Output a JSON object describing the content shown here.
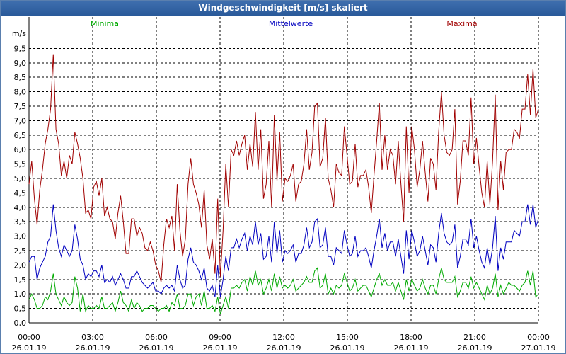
{
  "window": {
    "title": "Windgeschwindigkeit [m/s] skaliert"
  },
  "chart_data": {
    "type": "line",
    "title": "Windgeschwindigkeit [m/s] skaliert",
    "ylabel": "m/s",
    "xlabel": "",
    "ylim": [
      0,
      10
    ],
    "xlim": [
      0,
      24
    ],
    "grid": true,
    "y_ticks": [
      "0,0",
      "0,5",
      "1,0",
      "1,5",
      "2,0",
      "2,5",
      "3,0",
      "3,5",
      "4,0",
      "4,5",
      "5,0",
      "5,5",
      "6,0",
      "6,5",
      "7,0",
      "7,5",
      "8,0",
      "8,5",
      "9,0",
      "9,5"
    ],
    "x_ticks": [
      {
        "time": "00:00",
        "date": "26.01.19"
      },
      {
        "time": "03:00",
        "date": "26.01.19"
      },
      {
        "time": "06:00",
        "date": "26.01.19"
      },
      {
        "time": "09:00",
        "date": "26.01.19"
      },
      {
        "time": "12:00",
        "date": "26.01.19"
      },
      {
        "time": "15:00",
        "date": "26.01.19"
      },
      {
        "time": "18:00",
        "date": "26.01.19"
      },
      {
        "time": "21:00",
        "date": "26.01.19"
      },
      {
        "time": "00:00",
        "date": "27.01.19"
      }
    ],
    "series": [
      {
        "name": "Minima",
        "color": "#00aa00",
        "values": [
          0.8,
          1.0,
          0.8,
          0.5,
          0.5,
          0.6,
          0.9,
          0.8,
          1.1,
          1.7,
          1.0,
          0.8,
          0.6,
          0.9,
          0.7,
          0.6,
          0.7,
          1.6,
          1.2,
          0.4,
          1.0,
          0.4,
          0.6,
          0.5,
          0.5,
          0.6,
          0.5,
          0.9,
          0.5,
          0.5,
          0.6,
          0.7,
          0.4,
          0.7,
          1.1,
          0.7,
          0.6,
          0.4,
          0.8,
          0.5,
          0.7,
          0.6,
          0.4,
          0.5,
          0.5,
          0.6,
          0.6,
          0.5,
          0.4,
          0.5,
          0.5,
          0.6,
          0.4,
          0.7,
          0.6,
          1.0,
          0.5,
          0.5,
          0.6,
          1.0,
          1.0,
          0.6,
          0.9,
          1.0,
          0.6,
          1.1,
          0.5,
          0.5,
          0.6,
          0.4,
          0.9,
          0.3,
          0.6,
          0.9,
          0.5,
          1.2,
          1.2,
          1.3,
          1.2,
          1.4,
          1.5,
          1.1,
          1.6,
          1.3,
          1.8,
          1.3,
          1.5,
          1.0,
          1.2,
          1.5,
          1.1,
          1.7,
          1.2,
          1.6,
          1.2,
          1.3,
          1.2,
          1.3,
          1.5,
          1.1,
          1.2,
          1.3,
          1.4,
          1.6,
          1.4,
          1.4,
          1.8,
          1.9,
          1.2,
          1.3,
          1.7,
          1.0,
          1.2,
          1.0,
          1.3,
          1.2,
          1.3,
          1.7,
          1.4,
          1.1,
          1.2,
          1.5,
          1.1,
          1.2,
          1.3,
          1.3,
          1.1,
          0.9,
          1.2,
          1.5,
          1.7,
          1.3,
          1.5,
          1.3,
          1.3,
          1.4,
          1.1,
          1.4,
          1.1,
          0.8,
          1.5,
          1.1,
          1.5,
          1.3,
          1.1,
          1.2,
          1.5,
          1.2,
          1.0,
          1.3,
          1.3,
          1.0,
          1.5,
          1.9,
          1.5,
          1.4,
          1.4,
          1.4,
          1.6,
          0.9,
          1.1,
          1.4,
          1.4,
          1.2,
          1.6,
          1.2,
          1.4,
          1.2,
          1.0,
          0.8,
          1.3,
          1.0,
          1.2,
          1.7,
          0.9,
          1.3,
          1.0,
          1.2,
          1.4,
          1.3,
          1.3,
          1.2,
          1.1,
          1.3,
          1.4,
          1.8,
          1.3,
          1.8,
          0.9,
          1.0
        ]
      },
      {
        "name": "Mittelwerte",
        "color": "#0000c0",
        "values": [
          2.1,
          2.3,
          2.3,
          1.5,
          1.9,
          2.1,
          2.3,
          2.8,
          3.0,
          4.1,
          3.2,
          2.6,
          2.3,
          2.7,
          2.5,
          2.3,
          2.5,
          3.4,
          2.9,
          2.2,
          2.0,
          1.5,
          1.7,
          1.6,
          1.8,
          1.8,
          1.6,
          2.0,
          1.4,
          1.5,
          1.4,
          1.6,
          1.3,
          1.5,
          1.7,
          1.5,
          1.2,
          1.2,
          1.6,
          1.6,
          1.8,
          1.6,
          1.4,
          1.3,
          1.2,
          1.3,
          1.4,
          1.1,
          1.1,
          1.0,
          1.2,
          1.3,
          1.2,
          1.3,
          1.1,
          2.0,
          1.5,
          1.2,
          1.3,
          2.2,
          2.6,
          2.1,
          2.0,
          1.8,
          1.5,
          1.9,
          1.2,
          1.1,
          1.3,
          0.9,
          2.0,
          0.9,
          1.5,
          2.3,
          1.8,
          2.6,
          2.6,
          2.9,
          2.6,
          2.9,
          3.1,
          2.5,
          3.0,
          2.7,
          3.5,
          2.7,
          3.1,
          2.2,
          2.3,
          3.0,
          2.1,
          3.5,
          2.4,
          3.2,
          2.1,
          2.5,
          2.4,
          2.5,
          2.7,
          2.1,
          2.4,
          2.4,
          2.7,
          3.3,
          2.6,
          2.8,
          3.5,
          3.6,
          2.6,
          2.7,
          3.3,
          2.3,
          2.3,
          2.0,
          2.6,
          2.5,
          2.4,
          3.2,
          2.7,
          2.3,
          2.4,
          3.0,
          2.3,
          2.5,
          2.5,
          2.6,
          2.3,
          1.9,
          2.5,
          3.0,
          3.6,
          2.6,
          3.1,
          2.5,
          2.8,
          2.8,
          2.3,
          2.9,
          2.3,
          1.7,
          3.2,
          2.2,
          3.2,
          2.8,
          2.3,
          2.5,
          3.0,
          2.5,
          2.0,
          2.7,
          2.6,
          2.1,
          3.1,
          3.8,
          3.1,
          2.8,
          2.7,
          2.8,
          3.4,
          1.9,
          2.3,
          2.9,
          2.9,
          2.7,
          3.6,
          2.6,
          3.0,
          2.5,
          2.1,
          1.9,
          2.6,
          2.0,
          2.6,
          3.7,
          1.8,
          2.6,
          2.2,
          2.8,
          2.8,
          2.8,
          3.2,
          3.1,
          3.0,
          3.5,
          3.5,
          4.1,
          3.4,
          4.1,
          3.3,
          3.6
        ]
      },
      {
        "name": "Maxima",
        "color": "#a00000",
        "values": [
          4.8,
          5.6,
          4.3,
          3.4,
          4.6,
          5.3,
          6.2,
          6.7,
          7.4,
          9.3,
          6.7,
          6.2,
          5.1,
          5.6,
          5.0,
          5.8,
          5.5,
          6.6,
          6.2,
          5.7,
          5.0,
          3.8,
          3.9,
          3.6,
          4.7,
          4.9,
          4.4,
          5.0,
          3.7,
          4.0,
          3.6,
          3.5,
          2.9,
          3.8,
          4.4,
          3.5,
          2.4,
          2.4,
          3.6,
          3.6,
          3.0,
          3.3,
          3.1,
          2.6,
          2.5,
          2.8,
          2.5,
          2.0,
          1.8,
          1.4,
          2.7,
          3.6,
          3.3,
          3.7,
          2.5,
          4.8,
          3.2,
          2.3,
          2.9,
          4.8,
          5.7,
          4.8,
          4.5,
          4.1,
          3.3,
          4.6,
          2.7,
          2.2,
          2.9,
          1.7,
          4.3,
          1.6,
          3.2,
          5.5,
          4.0,
          6.0,
          5.8,
          6.3,
          5.8,
          6.2,
          6.5,
          5.3,
          6.2,
          5.4,
          7.3,
          5.3,
          6.7,
          4.3,
          4.8,
          6.3,
          4.0,
          7.2,
          4.9,
          6.6,
          4.2,
          5.0,
          4.9,
          5.1,
          5.5,
          4.2,
          4.8,
          4.9,
          5.5,
          6.7,
          5.3,
          5.9,
          7.5,
          7.6,
          5.4,
          5.7,
          7.1,
          5.0,
          4.6,
          4.0,
          5.5,
          5.2,
          5.1,
          6.8,
          5.8,
          4.8,
          4.9,
          6.2,
          4.7,
          5.1,
          5.1,
          5.3,
          4.7,
          3.8,
          5.1,
          6.3,
          7.6,
          5.3,
          6.5,
          5.3,
          6.0,
          5.8,
          4.8,
          6.3,
          4.8,
          3.5,
          6.8,
          4.5,
          6.8,
          6.0,
          4.7,
          5.3,
          6.3,
          5.2,
          4.2,
          5.7,
          5.5,
          4.6,
          6.6,
          8.0,
          6.5,
          5.9,
          5.8,
          6.0,
          7.4,
          4.1,
          4.9,
          6.3,
          6.3,
          5.8,
          7.8,
          5.5,
          6.4,
          5.4,
          4.5,
          4.0,
          5.6,
          4.1,
          5.6,
          7.9,
          3.9,
          5.6,
          4.6,
          5.9,
          6.0,
          6.0,
          6.7,
          6.6,
          6.4,
          7.4,
          7.4,
          8.6,
          7.2,
          8.8,
          7.1,
          7.4
        ]
      }
    ]
  }
}
